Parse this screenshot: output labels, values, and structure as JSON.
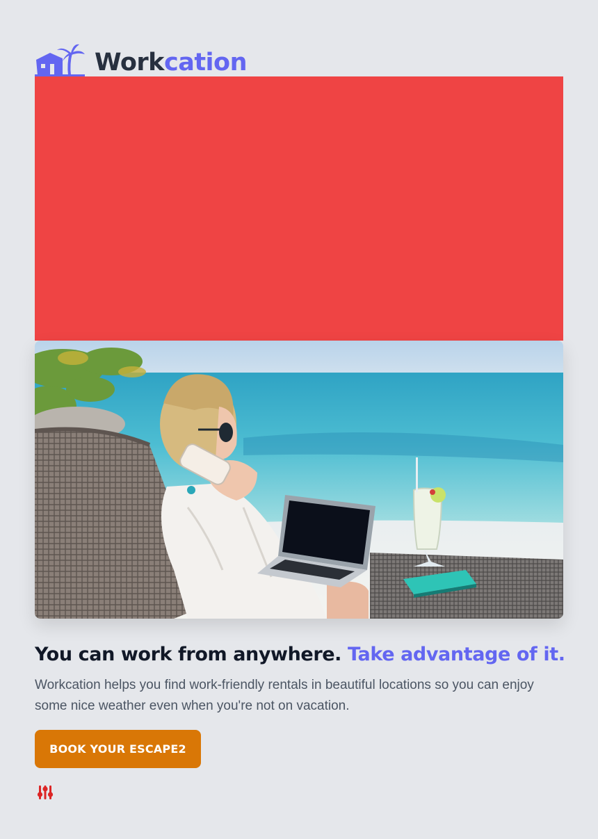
{
  "brand": {
    "name_part1": "Work",
    "name_part2": "cation",
    "logo_icon": "palm-house-logo-icon",
    "accent_color": "#6366f1"
  },
  "hero": {
    "panel_color": "#ef4444",
    "image_description_icon": "beach-workcation-photo"
  },
  "content": {
    "headline_main": "You can work from anywhere. ",
    "headline_accent": "Take advantage of it.",
    "lead": "Workcation helps you find work-friendly rentals in beautiful locations so you can enjoy some nice weather even when you're not on vacation."
  },
  "cta": {
    "label": "BOOK YOUR ESCAPE2",
    "color": "#d97706"
  },
  "controls": {
    "settings_icon": "sliders-icon",
    "settings_color": "#dc2626"
  }
}
